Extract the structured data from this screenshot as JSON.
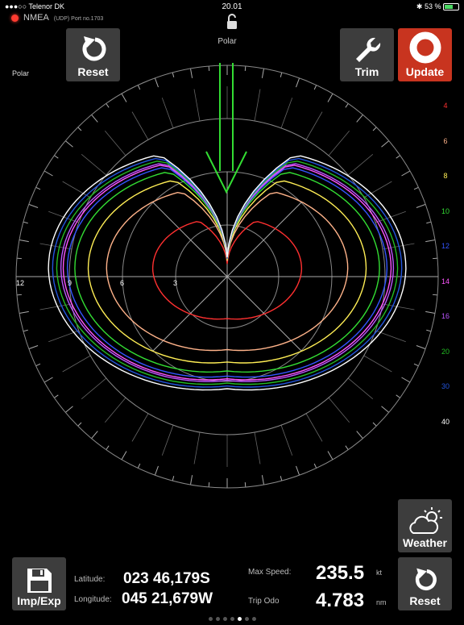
{
  "status_bar": {
    "carrier": "●●●○○ Telenor DK",
    "time": "20.01",
    "battery": "53 %"
  },
  "connection": {
    "label": "NMEA",
    "detail": "(UDP) Port no.1703"
  },
  "header": {
    "title": "Polar",
    "side_label": "Polar"
  },
  "buttons": {
    "reset_top": "Reset",
    "trim": "Trim",
    "update": "Update",
    "weather": "Weather",
    "imp_exp": "Imp/Exp",
    "reset_bottom": "Reset"
  },
  "ring_labels": [
    "12",
    "9",
    "6",
    "3"
  ],
  "speed_legend": [
    {
      "label": "4",
      "color": "#ff3030"
    },
    {
      "label": "6",
      "color": "#ffb38a"
    },
    {
      "label": "8",
      "color": "#ffee55"
    },
    {
      "label": "10",
      "color": "#33dd33"
    },
    {
      "label": "12",
      "color": "#3355ff"
    },
    {
      "label": "14",
      "color": "#ff55ff"
    },
    {
      "label": "16",
      "color": "#bb55ff"
    },
    {
      "label": "20",
      "color": "#22bb22"
    },
    {
      "label": "30",
      "color": "#2255dd"
    },
    {
      "label": "40",
      "color": "#ffffff"
    }
  ],
  "position": {
    "latitude_label": "Latitude:",
    "latitude": "023 46,179S",
    "longitude_label": "Longitude:",
    "longitude": "045 21,679W"
  },
  "stats": {
    "max_speed_label": "Max Speed:",
    "max_speed": "235.5",
    "max_speed_unit": "kt",
    "trip_label": "Trip Odo",
    "trip": "4.783",
    "trip_unit": "nm"
  },
  "pager": {
    "count": 7,
    "active": 4
  },
  "colors": {
    "wind_arrow": "#33dd33",
    "update_button": "#c8341f"
  }
}
